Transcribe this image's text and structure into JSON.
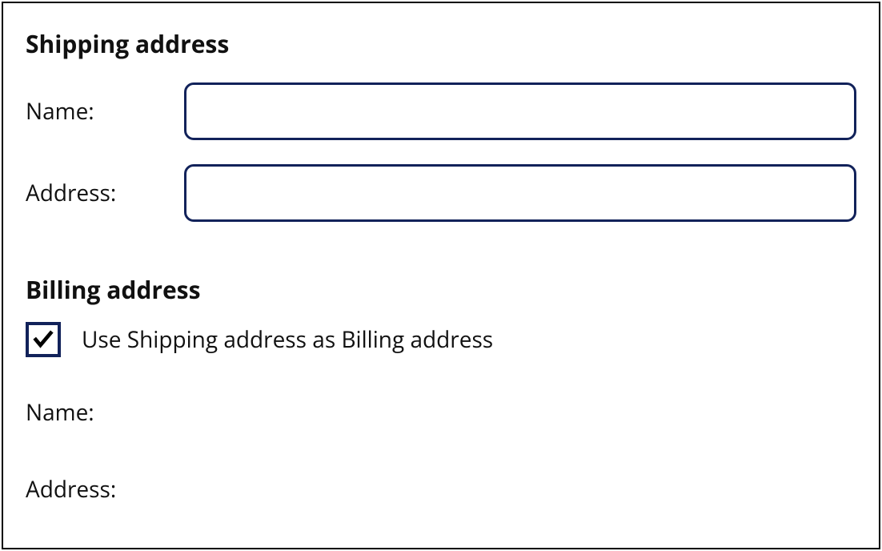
{
  "shipping": {
    "title": "Shipping address",
    "name_label": "Name:",
    "name_value": "",
    "address_label": "Address:",
    "address_value": ""
  },
  "billing": {
    "title": "Billing address",
    "use_shipping_label": "Use Shipping address as Billing address",
    "use_shipping_checked": true,
    "name_label": "Name:",
    "address_label": "Address:"
  }
}
